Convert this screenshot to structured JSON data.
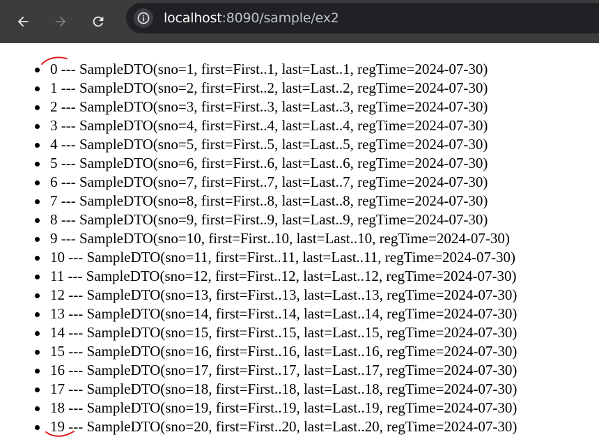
{
  "browser": {
    "url_host": "localhost",
    "url_rest": ":8090/sample/ex2",
    "icons": [
      "back-arrow-icon",
      "forward-arrow-icon",
      "reload-icon",
      "site-info-icon"
    ],
    "colors": {
      "toolbar": "#3c3c3c",
      "omnibox": "#202124",
      "annotation": "#e02020"
    }
  },
  "list": {
    "items": [
      "0 --- SampleDTO(sno=1, first=First..1, last=Last..1, regTime=2024-07-30)",
      "1 --- SampleDTO(sno=2, first=First..2, last=Last..2, regTime=2024-07-30)",
      "2 --- SampleDTO(sno=3, first=First..3, last=Last..3, regTime=2024-07-30)",
      "3 --- SampleDTO(sno=4, first=First..4, last=Last..4, regTime=2024-07-30)",
      "4 --- SampleDTO(sno=5, first=First..5, last=Last..5, regTime=2024-07-30)",
      "5 --- SampleDTO(sno=6, first=First..6, last=Last..6, regTime=2024-07-30)",
      "6 --- SampleDTO(sno=7, first=First..7, last=Last..7, regTime=2024-07-30)",
      "7 --- SampleDTO(sno=8, first=First..8, last=Last..8, regTime=2024-07-30)",
      "8 --- SampleDTO(sno=9, first=First..9, last=Last..9, regTime=2024-07-30)",
      "9 --- SampleDTO(sno=10, first=First..10, last=Last..10, regTime=2024-07-30)",
      "10 --- SampleDTO(sno=11, first=First..11, last=Last..11, regTime=2024-07-30)",
      "11 --- SampleDTO(sno=12, first=First..12, last=Last..12, regTime=2024-07-30)",
      "12 --- SampleDTO(sno=13, first=First..13, last=Last..13, regTime=2024-07-30)",
      "13 --- SampleDTO(sno=14, first=First..14, last=Last..14, regTime=2024-07-30)",
      "14 --- SampleDTO(sno=15, first=First..15, last=Last..15, regTime=2024-07-30)",
      "15 --- SampleDTO(sno=16, first=First..16, last=Last..16, regTime=2024-07-30)",
      "16 --- SampleDTO(sno=17, first=First..17, last=Last..17, regTime=2024-07-30)",
      "17 --- SampleDTO(sno=18, first=First..18, last=Last..18, regTime=2024-07-30)",
      "18 --- SampleDTO(sno=19, first=First..19, last=Last..19, regTime=2024-07-30)",
      "19 --- SampleDTO(sno=20, first=First..20, last=Last..20, regTime=2024-07-30)"
    ]
  }
}
